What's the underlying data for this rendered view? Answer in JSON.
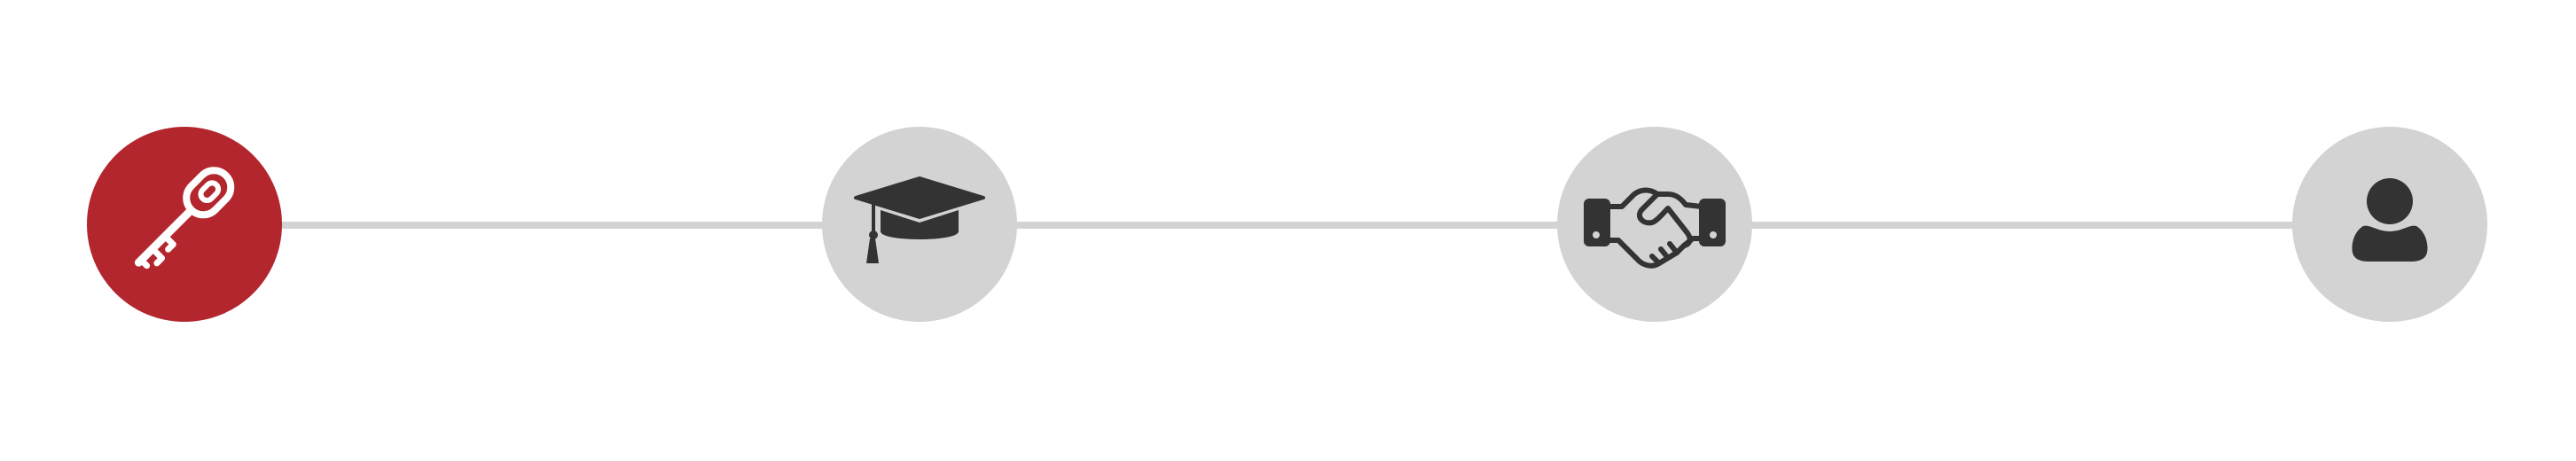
{
  "stepper": {
    "active_index": 0,
    "colors": {
      "active_circle": "#b3262d",
      "inactive_circle": "#d3d3d3",
      "connector": "#d3d3d3",
      "active_icon": "#ffffff",
      "inactive_icon": "#333333"
    },
    "steps": [
      {
        "icon": "key-icon",
        "state": "active"
      },
      {
        "icon": "graduation-cap-icon",
        "state": "inactive"
      },
      {
        "icon": "handshake-icon",
        "state": "inactive"
      },
      {
        "icon": "user-icon",
        "state": "inactive"
      }
    ]
  }
}
